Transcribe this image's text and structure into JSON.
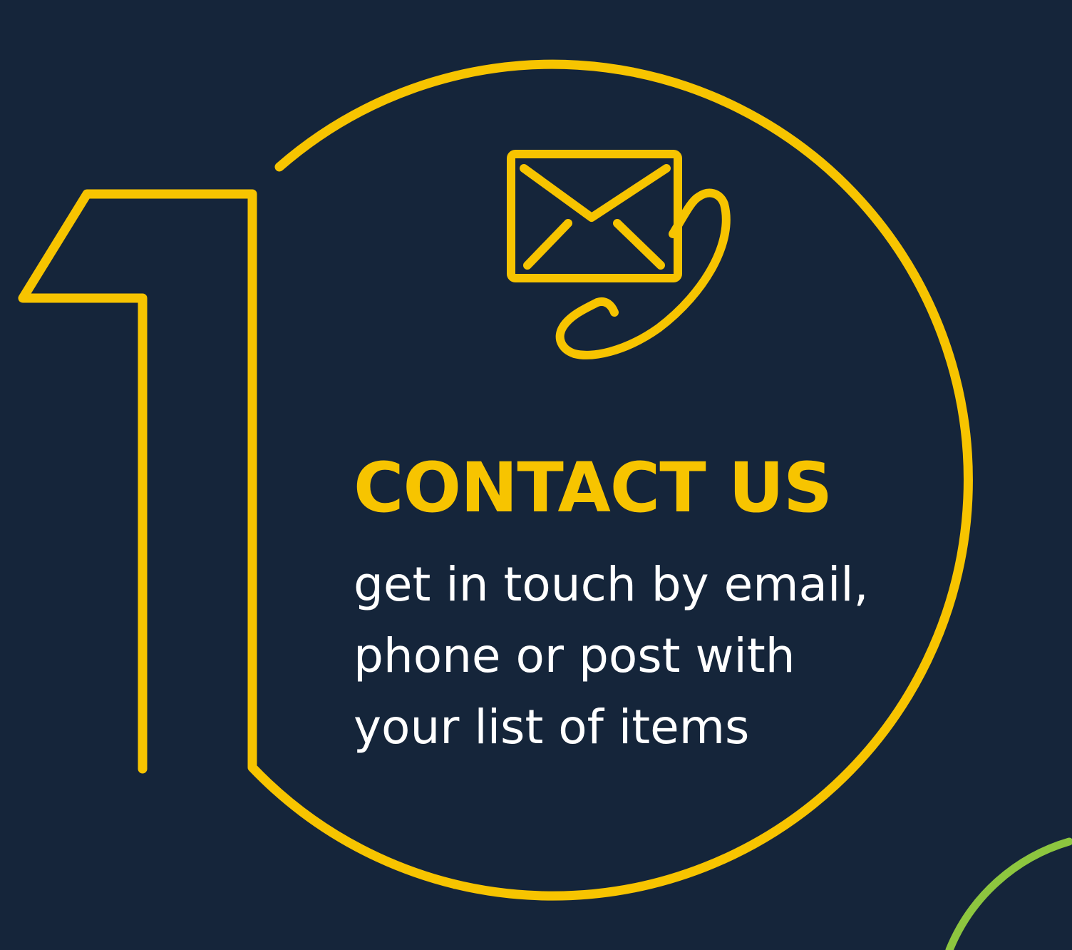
{
  "step": {
    "number": "1",
    "icon": "envelope-phone-icon",
    "title": "CONTACT US",
    "description_lines": [
      "get in touch by email,",
      "phone or post with",
      "your list of items"
    ]
  },
  "colors": {
    "background": "#15253a",
    "accent": "#f7c400",
    "text": "#ffffff",
    "secondary_accent": "#8dc63f"
  }
}
